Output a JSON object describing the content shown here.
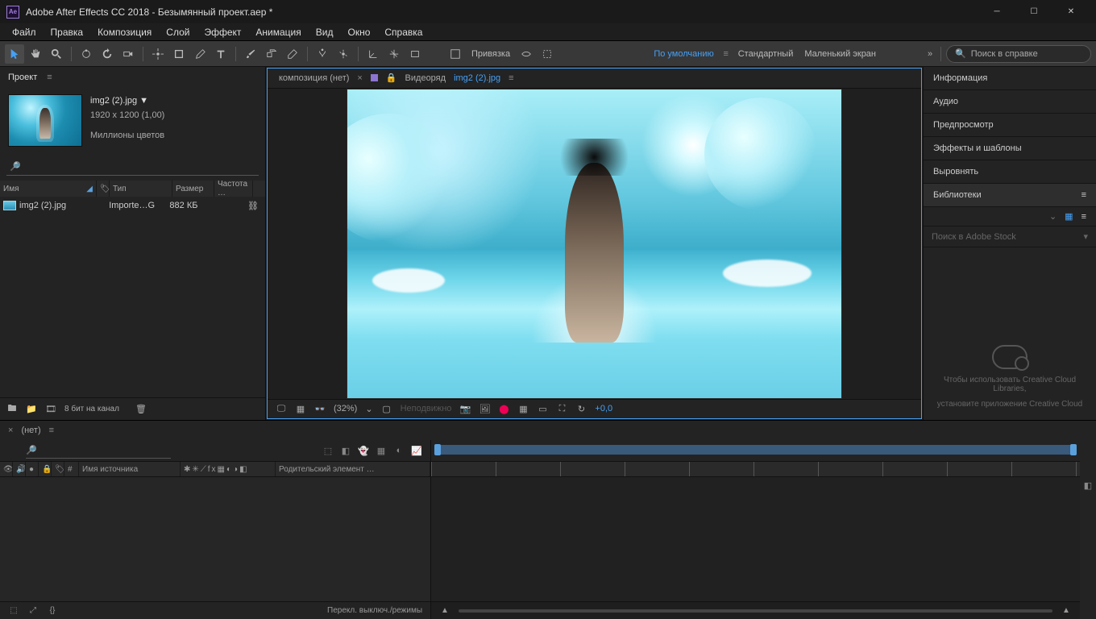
{
  "titlebar": {
    "app": "Adobe After Effects CC 2018",
    "file": "Безымянный проект.aep *"
  },
  "menu": [
    "Файл",
    "Правка",
    "Композиция",
    "Слой",
    "Эффект",
    "Анимация",
    "Вид",
    "Окно",
    "Справка"
  ],
  "toolbar": {
    "snap": "Привязка",
    "workspaces": [
      "По умолчанию",
      "Стандартный",
      "Маленький экран"
    ],
    "search_placeholder": "Поиск в справке"
  },
  "project": {
    "tab": "Проект",
    "filename": "img2 (2).jpg ▼",
    "dims": "1920 x 1200 (1,00)",
    "colors": "Миллионы цветов",
    "columns": {
      "name": "Имя",
      "type": "Тип",
      "size": "Размер",
      "rate": "Частота …"
    },
    "row": {
      "name": "img2 (2).jpg",
      "type": "Importe…G",
      "size": "882 КБ"
    },
    "bpc": "8 бит на канал"
  },
  "viewer": {
    "comp_none": "композиция (нет)",
    "footage": "Видеоряд",
    "filelabel": "img2 (2).jpg",
    "zoom": "(32%)",
    "still": "Неподвижно",
    "exposure": "+0,0"
  },
  "panels": [
    "Информация",
    "Аудио",
    "Предпросмотр",
    "Эффекты и шаблоны",
    "Выровнять",
    "Библиотеки"
  ],
  "stock_placeholder": "Поиск в Adobe Stock",
  "cc_msg1": "Чтобы использовать Creative Cloud Libraries,",
  "cc_msg2": "установите приложение Creative Cloud",
  "timeline": {
    "tab": "(нет)",
    "src": "Имя источника",
    "parent": "Родительский элемент …",
    "hash": "#",
    "toggle": "Перекл. выключ./режимы"
  }
}
